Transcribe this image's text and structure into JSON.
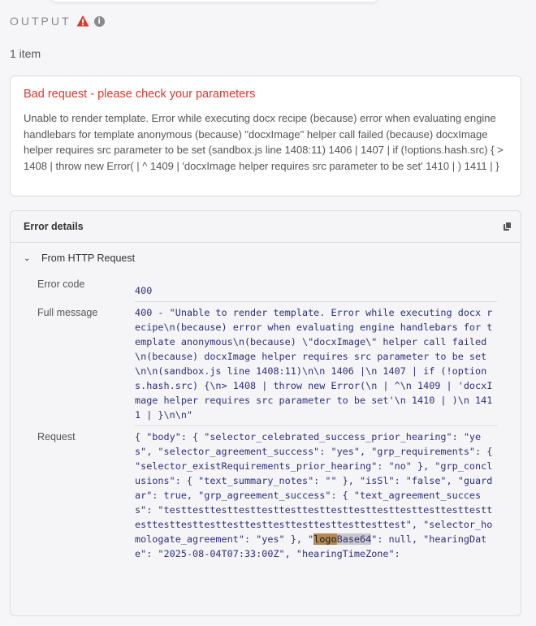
{
  "output": {
    "title": "OUTPUT",
    "item_count": "1 item"
  },
  "error": {
    "title": "Bad request - please check your parameters",
    "message": "Unable to render template. Error while executing docx recipe (because) error when evaluating engine handlebars for template anonymous (because) \"docxImage\" helper call failed (because) docxImage helper requires src parameter to be set (sandbox.js line 1408:11) 1406 | 1407 | if (!options.hash.src) { > 1408 | throw new Error( | ^ 1409 | 'docxImage helper requires src parameter to be set' 1410 | ) 1411 | }"
  },
  "details": {
    "title": "Error details",
    "section": "From HTTP Request",
    "error_code_label": "Error code",
    "error_code": "400",
    "full_message_label": "Full message",
    "full_message": "400 - \"Unable to render template. Error while executing docx recipe\\n(because) error when evaluating engine handlebars for template anonymous\\n(because) \\\"docxImage\\\" helper call failed\\n(because) docxImage helper requires src parameter to be set\\n\\n(sandbox.js line 1408:11)\\n\\n 1406 |\\n 1407 | if (!options.hash.src) {\\n> 1408 | throw new Error(\\n | ^\\n 1409 | 'docxImage helper requires src parameter to be set'\\n 1410 | )\\n 1411 | }\\n\\n\"",
    "request_label": "Request",
    "request_part1": "{ \"body\": { \"selector_celebrated_success_prior_hearing\": \"yes\", \"selector_agreement_success\": \"yes\", \"grp_requirements\": { \"selector_existRequirements_prior_hearing\": \"no\" }, \"grp_conclusions\": { \"text_summary_notes\": \"\" }, \"isSl\": \"false\", \"guardar\": true, \"grp_agreement_success\": { \"text_agreement_success\": \"testtesttesttesttesttesttesttesttesttesttesttesttesttesttesttesttesttesttesttesttesttesttesttesttesttest\", \"selector_homologate_agreement\": \"yes\" }, \"",
    "request_hl1": "logo",
    "request_hl2": "Base64",
    "request_part2": "\": null, \"hearingDate\": \"2025-08-04T07:33:00Z\", \"hearingTimeZone\":"
  }
}
